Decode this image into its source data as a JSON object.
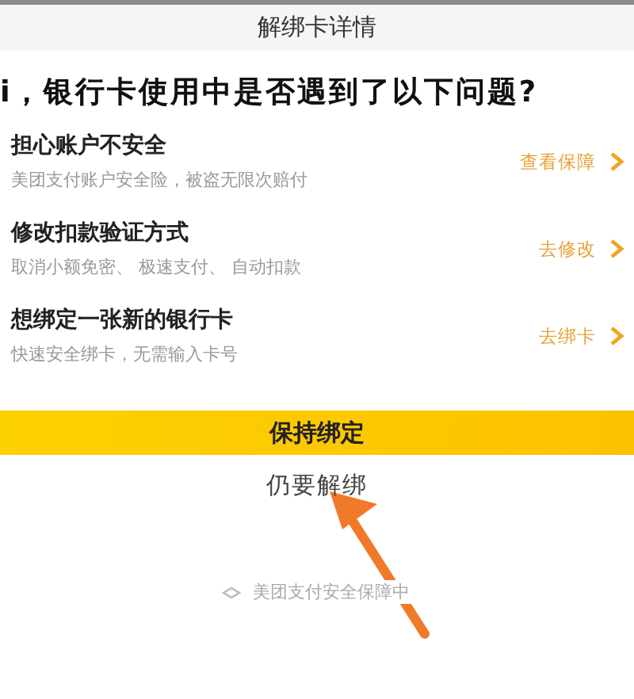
{
  "header": {
    "title": "解绑卡详情"
  },
  "question": "i，银行卡使用中是否遇到了以下问题?",
  "options": [
    {
      "title": "担心账户不安全",
      "subtitle": "美团支付账户安全险，被盗无限次赔付",
      "action": "查看保障"
    },
    {
      "title": "修改扣款验证方式",
      "subtitle": "取消小额免密、 极速支付、 自动扣款",
      "action": "去修改"
    },
    {
      "title": "想绑定一张新的银行卡",
      "subtitle": "快速安全绑卡，无需输入卡号",
      "action": "去绑卡"
    }
  ],
  "primary_button": "保持绑定",
  "secondary_link": "仍要解绑",
  "footer": "美团支付安全保障中"
}
